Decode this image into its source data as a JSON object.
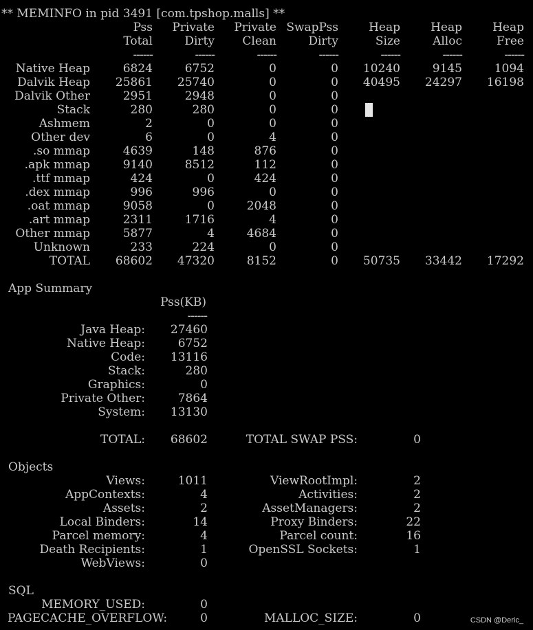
{
  "header": "** MEMINFO in pid 3491 [com.tpshop.malls] **",
  "columns": [
    {
      "top": "Pss",
      "bottom": "Total"
    },
    {
      "top": "Private",
      "bottom": "Dirty"
    },
    {
      "top": "Private",
      "bottom": "Clean"
    },
    {
      "top": "SwapPss",
      "bottom": "Dirty"
    },
    {
      "top": "Heap",
      "bottom": "Size"
    },
    {
      "top": "Heap",
      "bottom": "Alloc"
    },
    {
      "top": "Heap",
      "bottom": "Free"
    }
  ],
  "rule": "------",
  "rows": [
    {
      "label": "Native Heap",
      "values": [
        "6824",
        "6752",
        "0",
        "0",
        "10240",
        "9145",
        "1094"
      ]
    },
    {
      "label": "Dalvik Heap",
      "values": [
        "25861",
        "25740",
        "0",
        "0",
        "40495",
        "24297",
        "16198"
      ]
    },
    {
      "label": "Dalvik Other",
      "values": [
        "2951",
        "2948",
        "0",
        "0",
        "",
        "",
        ""
      ]
    },
    {
      "label": "Stack",
      "values": [
        "280",
        "280",
        "0",
        "0",
        "",
        "",
        ""
      ]
    },
    {
      "label": "Ashmem",
      "values": [
        "2",
        "0",
        "0",
        "0",
        "",
        "",
        ""
      ]
    },
    {
      "label": "Other dev",
      "values": [
        "6",
        "0",
        "4",
        "0",
        "",
        "",
        ""
      ]
    },
    {
      "label": ".so mmap",
      "values": [
        "4639",
        "148",
        "876",
        "0",
        "",
        "",
        ""
      ]
    },
    {
      "label": ".apk mmap",
      "values": [
        "9140",
        "8512",
        "112",
        "0",
        "",
        "",
        ""
      ]
    },
    {
      "label": ".ttf mmap",
      "values": [
        "424",
        "0",
        "424",
        "0",
        "",
        "",
        ""
      ]
    },
    {
      "label": ".dex mmap",
      "values": [
        "996",
        "996",
        "0",
        "0",
        "",
        "",
        ""
      ]
    },
    {
      "label": ".oat mmap",
      "values": [
        "9058",
        "0",
        "2048",
        "0",
        "",
        "",
        ""
      ]
    },
    {
      "label": ".art mmap",
      "values": [
        "2311",
        "1716",
        "4",
        "0",
        "",
        "",
        ""
      ]
    },
    {
      "label": "Other mmap",
      "values": [
        "5877",
        "4",
        "4684",
        "0",
        "",
        "",
        ""
      ]
    },
    {
      "label": "Unknown",
      "values": [
        "233",
        "224",
        "0",
        "0",
        "",
        "",
        ""
      ]
    },
    {
      "label": "TOTAL",
      "values": [
        "68602",
        "47320",
        "8152",
        "0",
        "50735",
        "33442",
        "17292"
      ]
    }
  ],
  "app_summary": {
    "title": "App Summary",
    "col_header": "Pss(KB)",
    "rule": "------",
    "items": [
      {
        "label": "Java Heap:",
        "value": "27460"
      },
      {
        "label": "Native Heap:",
        "value": "6752"
      },
      {
        "label": "Code:",
        "value": "13116"
      },
      {
        "label": "Stack:",
        "value": "280"
      },
      {
        "label": "Graphics:",
        "value": "0"
      },
      {
        "label": "Private Other:",
        "value": "7864"
      },
      {
        "label": "System:",
        "value": "13130"
      }
    ],
    "total_label": "TOTAL:",
    "total_value": "68602",
    "swap_label": "TOTAL SWAP PSS:",
    "swap_value": "0"
  },
  "objects": {
    "title": "Objects",
    "left": [
      {
        "label": "Views:",
        "value": "1011"
      },
      {
        "label": "AppContexts:",
        "value": "4"
      },
      {
        "label": "Assets:",
        "value": "2"
      },
      {
        "label": "Local Binders:",
        "value": "14"
      },
      {
        "label": "Parcel memory:",
        "value": "4"
      },
      {
        "label": "Death Recipients:",
        "value": "1"
      },
      {
        "label": "WebViews:",
        "value": "0"
      }
    ],
    "right": [
      {
        "label": "ViewRootImpl:",
        "value": "2"
      },
      {
        "label": "Activities:",
        "value": "2"
      },
      {
        "label": "AssetManagers:",
        "value": "2"
      },
      {
        "label": "Proxy Binders:",
        "value": "22"
      },
      {
        "label": "Parcel count:",
        "value": "16"
      },
      {
        "label": "OpenSSL Sockets:",
        "value": "1"
      }
    ]
  },
  "sql": {
    "title": "SQL",
    "items": [
      {
        "label": "MEMORY_USED:",
        "value": "0"
      },
      {
        "label": "PAGECACHE_OVERFLOW:",
        "value": "0"
      }
    ],
    "malloc_label": "MALLOC_SIZE:",
    "malloc_value": "0"
  },
  "watermark": "CSDN @Deric_"
}
